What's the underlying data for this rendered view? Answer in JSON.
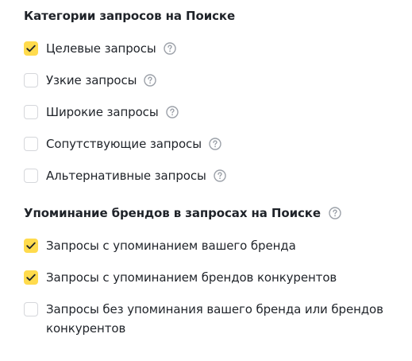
{
  "search_categories": {
    "title": "Категории запросов на Поиске",
    "items": [
      {
        "label": "Целевые запросы",
        "checked": true
      },
      {
        "label": "Узкие запросы",
        "checked": false
      },
      {
        "label": "Широкие запросы",
        "checked": false
      },
      {
        "label": "Сопутствующие запросы",
        "checked": false
      },
      {
        "label": "Альтернативные запросы",
        "checked": false
      }
    ]
  },
  "brand_mentions": {
    "title": "Упоминание брендов в запросах на Поиске",
    "items": [
      {
        "label": "Запросы с упоминанием вашего бренда",
        "checked": true
      },
      {
        "label": "Запросы с упоминанием брендов конкурентов",
        "checked": true
      },
      {
        "label": "Запросы без упоминания вашего бренда или брендов конкурентов",
        "checked": false
      }
    ]
  },
  "colors": {
    "checkbox_checked": "#ffdb4d",
    "checkbox_border": "#d5d7db",
    "help_icon": "#9ba0a8",
    "text": "#1f2329"
  },
  "icons": {
    "check": "check-icon",
    "help": "question-circle-icon"
  }
}
